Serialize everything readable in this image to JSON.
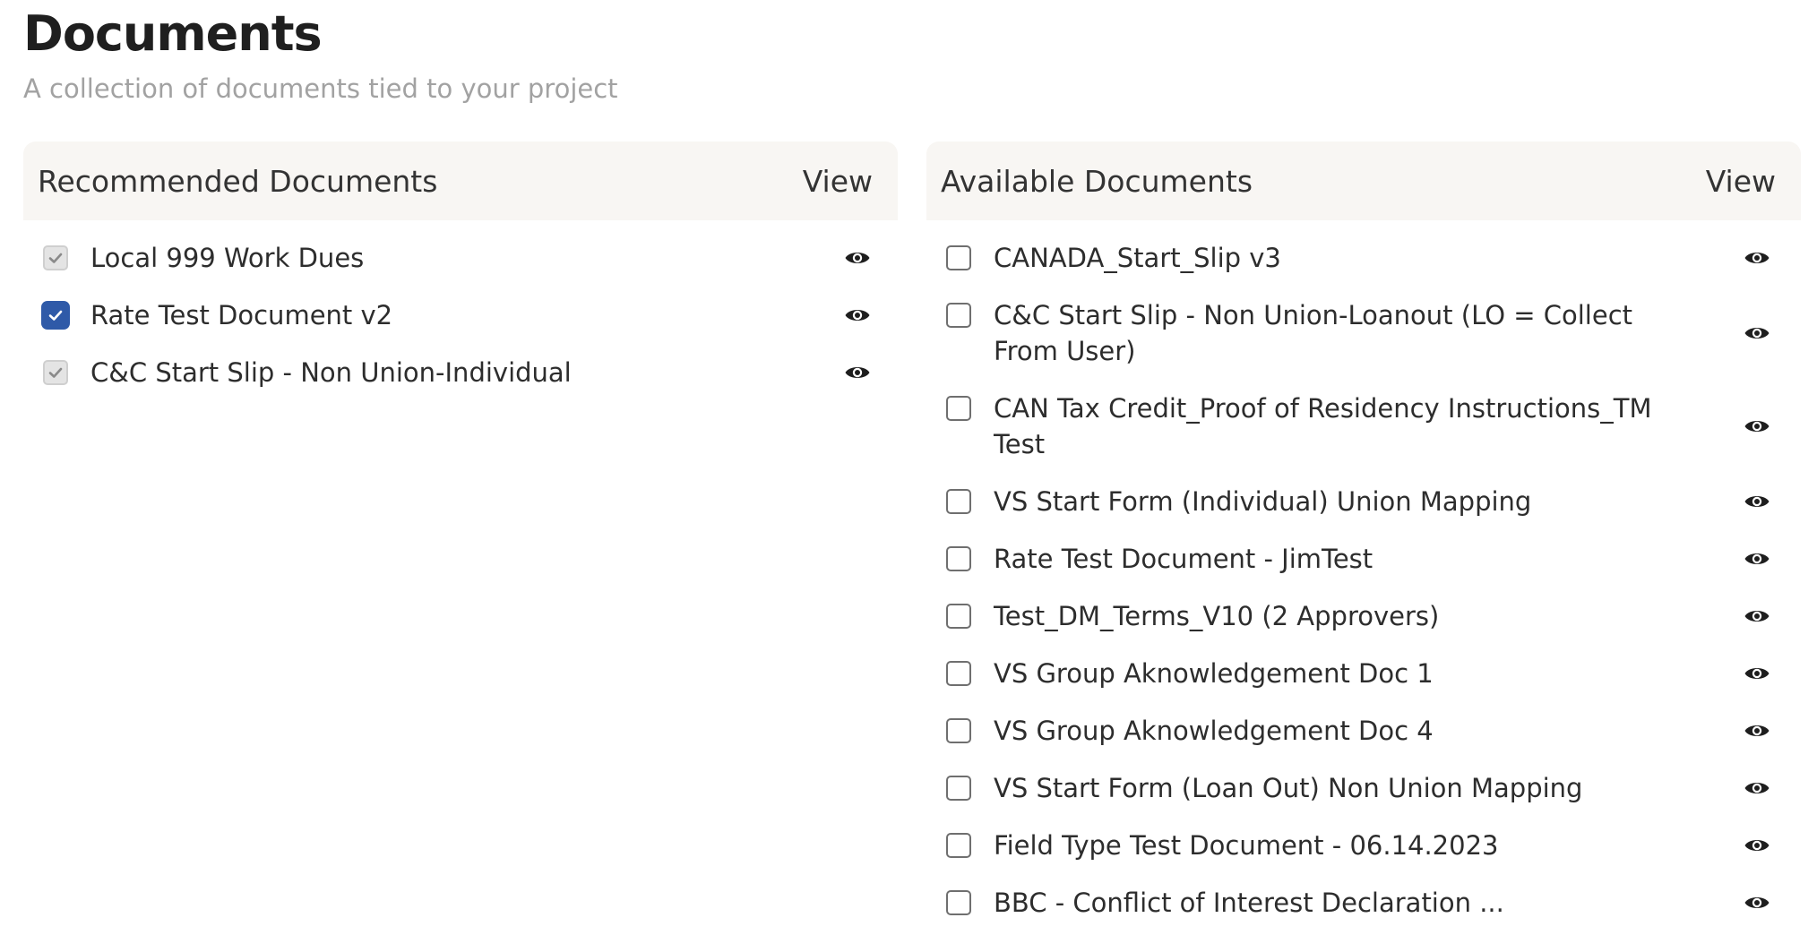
{
  "page": {
    "title": "Documents",
    "subtitle": "A collection of documents tied to your project"
  },
  "recommended": {
    "header": "Recommended Documents",
    "view_label": "View",
    "items": [
      {
        "label": "Local 999 Work Dues",
        "state": "disabled-checked"
      },
      {
        "label": "Rate Test Document v2",
        "state": "checked"
      },
      {
        "label": "C&C Start Slip - Non Union-Individual",
        "state": "disabled-checked"
      }
    ]
  },
  "available": {
    "header": "Available Documents",
    "view_label": "View",
    "items": [
      {
        "label": "CANADA_Start_Slip v3",
        "state": "unchecked"
      },
      {
        "label": "C&C Start Slip - Non Union-Loanout (LO = Collect From User)",
        "state": "unchecked"
      },
      {
        "label": "CAN Tax Credit_Proof of Residency Instructions_TM Test",
        "state": "unchecked"
      },
      {
        "label": "VS Start Form (Individual) Union Mapping",
        "state": "unchecked"
      },
      {
        "label": "Rate Test Document - JimTest",
        "state": "unchecked"
      },
      {
        "label": "Test_DM_Terms_V10 (2 Approvers)",
        "state": "unchecked"
      },
      {
        "label": "VS Group Aknowledgement Doc 1",
        "state": "unchecked"
      },
      {
        "label": "VS Group Aknowledgement Doc 4",
        "state": "unchecked"
      },
      {
        "label": "VS Start Form (Loan Out) Non Union Mapping",
        "state": "unchecked"
      },
      {
        "label": "Field Type Test Document - 06.14.2023",
        "state": "unchecked"
      },
      {
        "label": "BBC - Conflict of Interest Declaration ...",
        "state": "unchecked"
      }
    ]
  },
  "icons": {
    "row_action": "eye-icon",
    "check": "check-icon"
  },
  "colors": {
    "accent": "#2f5aa8",
    "header_bg": "#f8f6f3",
    "subtitle": "#a2a2a2"
  }
}
